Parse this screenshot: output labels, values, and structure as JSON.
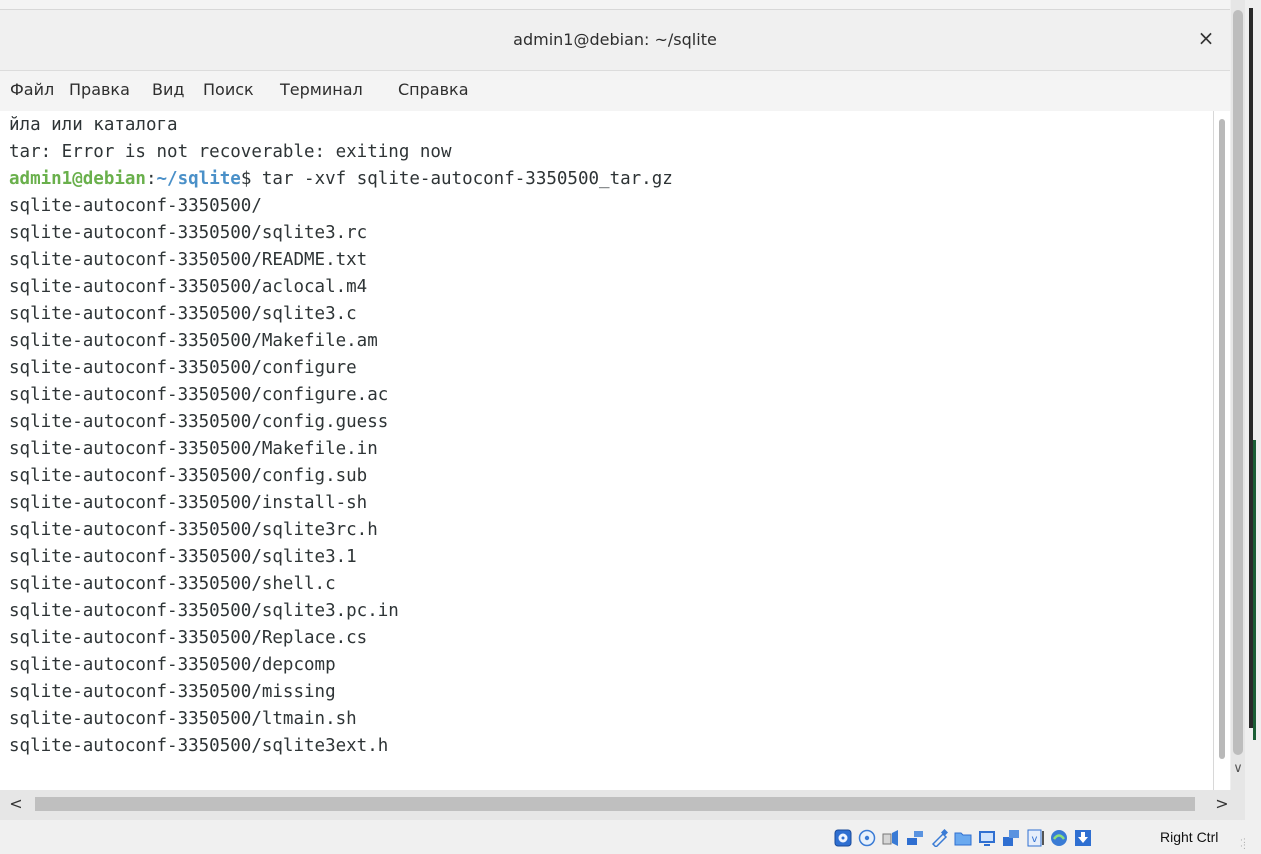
{
  "window": {
    "title": "admin1@debian: ~/sqlite",
    "close_glyph": "×"
  },
  "menu": [
    "Файл",
    "Правка",
    "Вид",
    "Поиск",
    "Терминал",
    "Справка"
  ],
  "terminal": {
    "pre_lines": [
      "йла или каталога",
      "tar: Error is not recoverable: exiting now"
    ],
    "prompt": {
      "user_host": "admin1@debian",
      "sep": ":",
      "path": "~/sqlite",
      "symbol": "$",
      "command": " tar -xvf sqlite-autoconf-3350500_tar.gz"
    },
    "output_lines": [
      "sqlite-autoconf-3350500/",
      "sqlite-autoconf-3350500/sqlite3.rc",
      "sqlite-autoconf-3350500/README.txt",
      "sqlite-autoconf-3350500/aclocal.m4",
      "sqlite-autoconf-3350500/sqlite3.c",
      "sqlite-autoconf-3350500/Makefile.am",
      "sqlite-autoconf-3350500/configure",
      "sqlite-autoconf-3350500/configure.ac",
      "sqlite-autoconf-3350500/config.guess",
      "sqlite-autoconf-3350500/Makefile.in",
      "sqlite-autoconf-3350500/config.sub",
      "sqlite-autoconf-3350500/install-sh",
      "sqlite-autoconf-3350500/sqlite3rc.h",
      "sqlite-autoconf-3350500/sqlite3.1",
      "sqlite-autoconf-3350500/shell.c",
      "sqlite-autoconf-3350500/sqlite3.pc.in",
      "sqlite-autoconf-3350500/Replace.cs",
      "sqlite-autoconf-3350500/depcomp",
      "sqlite-autoconf-3350500/missing",
      "sqlite-autoconf-3350500/ltmain.sh",
      "sqlite-autoconf-3350500/sqlite3ext.h"
    ]
  },
  "colors": {
    "prompt_user": "#6ab04c",
    "prompt_path": "#4a90c8",
    "text": "#2e3436"
  },
  "scroll": {
    "down_glyph": "∨",
    "left_glyph": "<",
    "right_glyph": ">"
  },
  "statusbar": {
    "icons": [
      "hard-disk-icon",
      "optical-drive-icon",
      "audio-icon",
      "network-icon",
      "usb-icon",
      "shared-folder-icon",
      "display-icon",
      "network-activity-icon",
      "vrde-icon",
      "mouse-integration-icon",
      "keyboard-capture-icon"
    ],
    "host_key": "Right Ctrl"
  }
}
